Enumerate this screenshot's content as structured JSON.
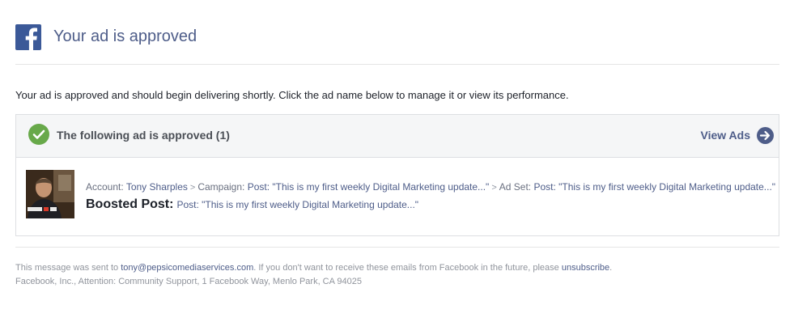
{
  "header": {
    "logo_icon": "facebook-f-icon",
    "brand_color": "#3b5998",
    "title": "Your ad is approved"
  },
  "intro": "Your ad is approved and should begin delivering shortly. Click the ad name below to manage it or view its performance.",
  "card": {
    "status_icon": "green-check-circle-icon",
    "title": "The following ad is approved (1)",
    "view_ads_label": "View Ads",
    "view_ads_icon": "arrow-right-circle-icon",
    "thumbnail_icon": "ad-thumbnail-image",
    "account_prefix": "Account:",
    "account_name": "Tony Sharples",
    "campaign_prefix": "Campaign:",
    "campaign_name": "Post: \"This is my first weekly Digital Marketing update...\"",
    "adset_prefix": "Ad Set:",
    "adset_name": "Post: \"This is my first weekly Digital Marketing update...\"",
    "boosted_label": "Boosted Post:",
    "boosted_name": "Post: \"This is my first weekly Digital Marketing update...\""
  },
  "footer": {
    "line1_prefix": "This message was sent to",
    "email": "tony@pepsicomediaservices.com",
    "line1_middle": ". If you don't want to receive these emails from Facebook in the future, please",
    "unsubscribe": "unsubscribe",
    "line1_suffix": ".",
    "line2": "Facebook, Inc., Attention: Community Support, 1 Facebook Way, Menlo Park, CA 94025"
  },
  "colors": {
    "link": "#4e5d89",
    "check_green": "#68a94a",
    "card_header_bg": "#f5f6f7"
  }
}
